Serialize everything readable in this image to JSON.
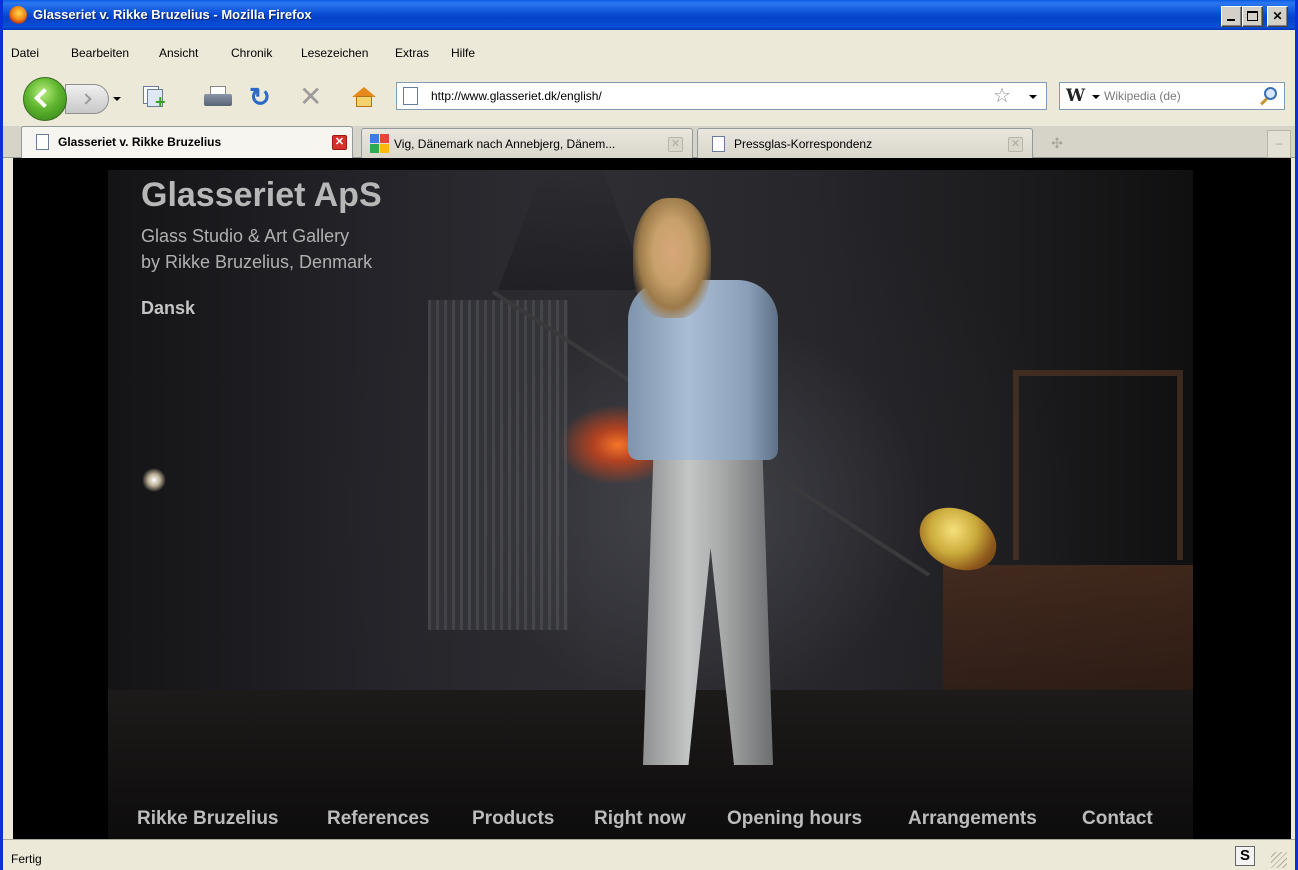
{
  "window": {
    "title": "Glasseriet v. Rikke Bruzelius - Mozilla Firefox"
  },
  "menubar": {
    "items": [
      {
        "label": "Datei"
      },
      {
        "label": "Bearbeiten"
      },
      {
        "label": "Ansicht"
      },
      {
        "label": "Chronik"
      },
      {
        "label": "Lesezeichen"
      },
      {
        "label": "Extras"
      },
      {
        "label": "Hilfe"
      }
    ]
  },
  "navbar": {
    "url": "http://www.glasseriet.dk/english/",
    "search_placeholder": "Wikipedia (de)",
    "search_engine_icon": "W"
  },
  "tabs": [
    {
      "label": "Glasseriet v. Rikke Bruzelius",
      "active": true
    },
    {
      "label": "Vig, Dänemark nach Annebjerg, Dänem...",
      "active": false
    },
    {
      "label": "Pressglas-Korrespondenz",
      "active": false
    }
  ],
  "page": {
    "title": "Glasseriet ApS",
    "subtitle_line1": "Glass Studio & Art Gallery",
    "subtitle_line2": "by Rikke Bruzelius, Denmark",
    "language_link": "Dansk",
    "nav": [
      {
        "label": "Rikke Bruzelius"
      },
      {
        "label": "References"
      },
      {
        "label": "Products"
      },
      {
        "label": "Right now"
      },
      {
        "label": "Opening hours"
      },
      {
        "label": "Arrangements"
      },
      {
        "label": "Contact"
      }
    ]
  },
  "statusbar": {
    "text": "Fertig",
    "addon_icon": "S"
  },
  "colors": {
    "titlebar": "#0a4fd6",
    "chrome": "#ece9d8",
    "page_background": "#000000",
    "page_text": "#bcbcbc"
  },
  "icons": [
    "firefox-icon",
    "back-arrow-icon",
    "forward-arrow-icon",
    "new-tab-icon",
    "print-icon",
    "reload-icon",
    "stop-icon",
    "home-icon",
    "page-icon",
    "bookmark-star-icon",
    "wikipedia-icon",
    "search-magnifier-icon",
    "tab-close-icon",
    "google-icon",
    "statusbar-s-icon",
    "resize-grip-icon"
  ]
}
